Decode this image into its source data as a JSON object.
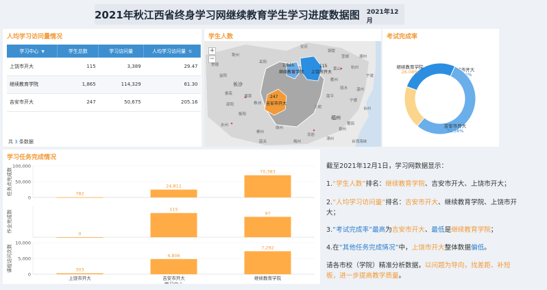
{
  "header": {
    "title": "2021年秋江西省终身学习网继续教育学生学习进度数据图",
    "date": "2021年12月"
  },
  "table_panel": {
    "title": "人均学习访问量情况",
    "columns": [
      "学习中心",
      "学生总数",
      "学习访问量",
      "人均学习访问量"
    ],
    "rows": [
      [
        "上饶市开大",
        "115",
        "3,389",
        "29.47"
      ],
      [
        "继续教育学院",
        "1,865",
        "114,329",
        "61.30"
      ],
      [
        "吉安市开大",
        "247",
        "50,675",
        "205.16"
      ]
    ],
    "footer": {
      "prefix": "共",
      "count": "3",
      "suffix": "条数据"
    }
  },
  "map_panel": {
    "title": "学生人数",
    "zoom_in": "+",
    "zoom_out": "−",
    "regions": [
      {
        "value": "1,865",
        "name": "继续教育学院"
      },
      {
        "value": "115",
        "name": "上饶市开大"
      },
      {
        "value": "247",
        "name": "吉安市开大"
      }
    ],
    "cities": [
      "长沙",
      "福州",
      "台湾海峡"
    ],
    "minor_cities": [
      "荆州",
      "岳阳",
      "益阳",
      "湘潭",
      "株洲",
      "衡阳",
      "郴州",
      "赣州",
      "龙岩",
      "三明",
      "南平",
      "宁德",
      "温州",
      "衢州",
      "杭州",
      "黄山",
      "安庆",
      "铜陵",
      "宣城",
      "湖州",
      "宁波",
      "丽水",
      "台州",
      "泉州",
      "莆田",
      "漳州",
      "邵阳",
      "娄底",
      "常德",
      "永州",
      "韶关",
      "梅州"
    ]
  },
  "donut_panel": {
    "title": "考试完成率",
    "chart_data": {
      "type": "pie",
      "slices": [
        {
          "name": "上饶市开大",
          "value": 35.26,
          "label": "35.26%",
          "color": "#2c8ee0"
        },
        {
          "name": "吉安市开大",
          "value": 72.56,
          "label": "72.56%",
          "color": "#6aaeea"
        },
        {
          "name": "继续教育学院",
          "value": 26.08,
          "label": "26.08%",
          "color": "#fbd58c"
        }
      ]
    }
  },
  "task_panel": {
    "title": "学习任务完成情况",
    "chart_data": {
      "type": "bar",
      "categories": [
        "上饶市开大",
        "吉安市开大",
        "继续教育学院"
      ],
      "xlabel": "学习中心",
      "panels": [
        {
          "ylabel": "任务点完成数",
          "ylim": [
            0,
            100000
          ],
          "ticks": [
            "100,000",
            "50,000",
            "0"
          ],
          "values": [
            782,
            24811,
            70383
          ],
          "labels": [
            "782",
            "24,811",
            "70,383"
          ]
        },
        {
          "ylabel": "作业完成数",
          "ylim": [
            0,
            150
          ],
          "ticks": [],
          "values": [
            0,
            115,
            97
          ],
          "labels": [
            "0",
            "115",
            "97"
          ]
        },
        {
          "ylabel": "课程访问次数",
          "ylim": [
            0,
            10000
          ],
          "ticks": [
            "10,000",
            "5,000",
            "0"
          ],
          "values": [
            303,
            4806,
            7292
          ],
          "labels": [
            "303",
            "4,806",
            "7,292"
          ]
        }
      ],
      "bar_color": "#ffac47"
    }
  },
  "text_panel": {
    "intro": "截至2021年12月1日，学习网数据显示：",
    "p1": {
      "a": "1.",
      "b": "“学生人数”",
      "c": "排名：",
      "d": "继续教育学院",
      "e": "、吉安市开大、上饶市开大；"
    },
    "p2": {
      "a": "2.",
      "b": "“人均学习访问量”",
      "c": "排名：",
      "d": "吉安市开大",
      "e": "、继续教育学院、上饶市开",
      "f": "大；"
    },
    "p3": {
      "a": "3.",
      "b": "“考试完成率”",
      "c": "最高",
      "d": "为",
      "e": "吉安市开大",
      "f": "、",
      "g": "最低",
      "h": "是",
      "i": "继续教育学院",
      "j": "；"
    },
    "p4": {
      "a": "4.在",
      "b": "“其他任务完成情况”",
      "c": "中，",
      "d": "上饶市开大",
      "e": "整体数据",
      "f": "偏低",
      "g": "。"
    },
    "p5": {
      "a": "请各市校（学院）精准分析数据，",
      "b": "以问题为导向，找差距、补短",
      "c": "板，进一步提高教学质量",
      "d": "。"
    }
  }
}
